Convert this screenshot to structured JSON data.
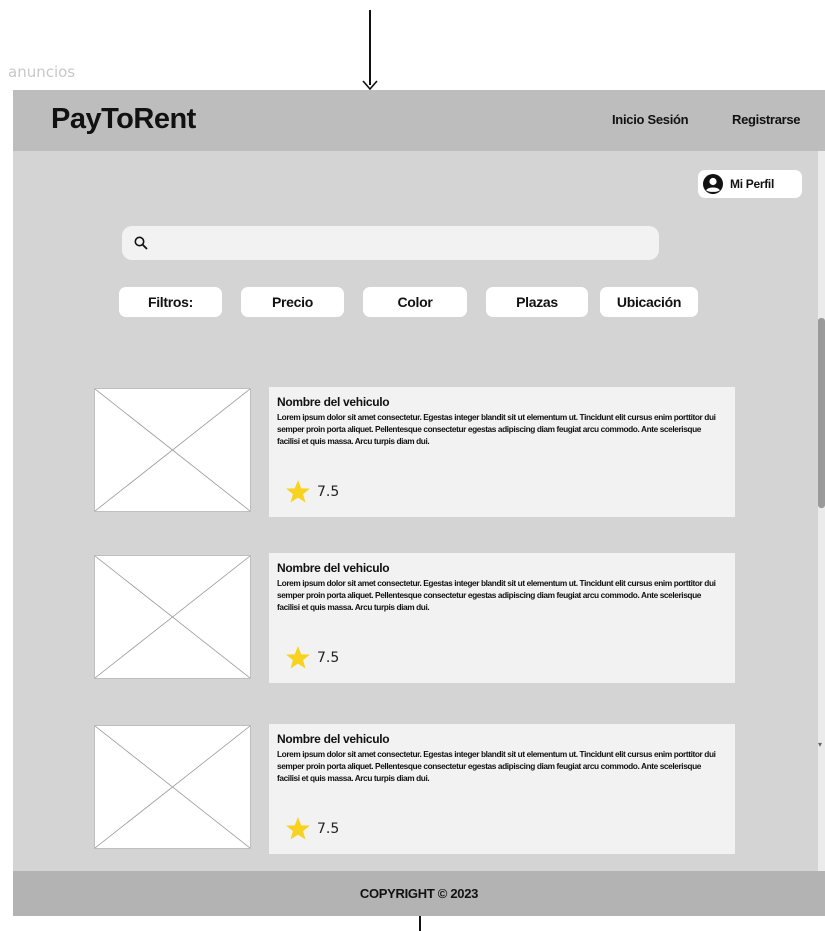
{
  "frame_label": "anuncios",
  "header": {
    "brand": "PayToRent",
    "login": "Inicio Sesión",
    "register": "Registrarse"
  },
  "profile": {
    "label": "Mi Perfil",
    "icon": "user-circle-icon"
  },
  "search": {
    "placeholder": "",
    "icon": "search-icon"
  },
  "filters": {
    "label": "Filtros:",
    "items": [
      "Precio",
      "Color",
      "Plazas",
      "Ubicación"
    ]
  },
  "listings": [
    {
      "title": "Nombre del vehiculo",
      "description": "Lorem ipsum dolor sit amet consectetur. Egestas integer blandit sit ut elementum ut. Tincidunt elit cursus enim porttitor dui semper proin porta aliquet. Pellentesque consectetur egestas adipiscing diam feugiat arcu commodo. Ante scelerisque facilisi et quis massa. Arcu turpis diam dui.",
      "rating": "7.5"
    },
    {
      "title": "Nombre del vehiculo",
      "description": "Lorem ipsum dolor sit amet consectetur. Egestas integer blandit sit ut elementum ut. Tincidunt elit cursus enim porttitor dui semper proin porta aliquet. Pellentesque consectetur egestas adipiscing diam feugiat arcu commodo. Ante scelerisque facilisi et quis massa. Arcu turpis diam dui.",
      "rating": "7.5"
    },
    {
      "title": "Nombre del vehiculo",
      "description": "Lorem ipsum dolor sit amet consectetur. Egestas integer blandit sit ut elementum ut. Tincidunt elit cursus enim porttitor dui semper proin porta aliquet. Pellentesque consectetur egestas adipiscing diam feugiat arcu commodo. Ante scelerisque facilisi et quis massa. Arcu turpis diam dui.",
      "rating": "7.5"
    }
  ],
  "footer": {
    "copyright": "COPYRIGHT © 2023"
  },
  "colors": {
    "frame_bg": "#d4d4d4",
    "header_bg": "#bdbdbd",
    "footer_bg": "#b3b3b3",
    "card_bg": "#f2f2f2",
    "star": "#f7d21e"
  }
}
